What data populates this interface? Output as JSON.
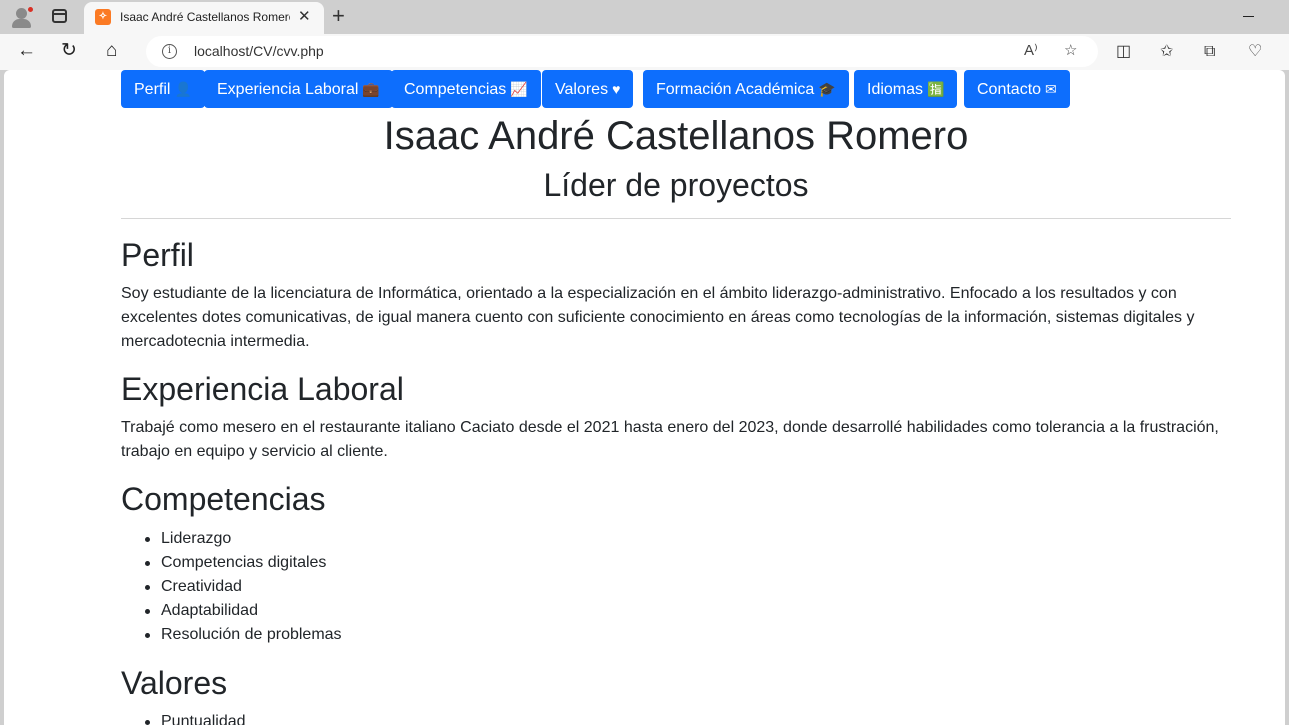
{
  "browser": {
    "tab_title": "Isaac André Castellanos Romero",
    "favicon_glyph": "✧",
    "url": "localhost/CV/cvv.php"
  },
  "nav": [
    {
      "label": "Perfil",
      "icon": "user-icon",
      "glyph": "👤"
    },
    {
      "label": "Experiencia Laboral",
      "icon": "briefcase-icon",
      "glyph": "💼"
    },
    {
      "label": "Competencias",
      "icon": "chart-line-icon",
      "glyph": "📈"
    },
    {
      "label": "Valores",
      "icon": "heart-icon",
      "glyph": "♥"
    },
    {
      "label": "Formación Académica",
      "icon": "graduation-cap-icon",
      "glyph": "🎓"
    },
    {
      "label": "Idiomas",
      "icon": "language-icon",
      "glyph": "🈯"
    },
    {
      "label": "Contacto",
      "icon": "envelope-icon",
      "glyph": "✉"
    }
  ],
  "header": {
    "name": "Isaac André Castellanos Romero",
    "role": "Líder de proyectos"
  },
  "sections": {
    "perfil": {
      "title": "Perfil",
      "text": "Soy estudiante de la licenciatura de Informática, orientado a la especialización en el ámbito liderazgo-administrativo. Enfocado a los resultados y con excelentes dotes comunicativas, de igual manera cuento con suficiente conocimiento en áreas como tecnologías de la información, sistemas digitales y mercadotecnia intermedia."
    },
    "experiencia": {
      "title": "Experiencia Laboral",
      "text": "Trabajé como mesero en el restaurante italiano Caciato desde el 2021 hasta enero del 2023, donde desarrollé habilidades como tolerancia a la frustración, trabajo en equipo y servicio al cliente."
    },
    "competencias": {
      "title": "Competencias",
      "items": [
        "Liderazgo",
        "Competencias digitales",
        "Creatividad",
        "Adaptabilidad",
        "Resolución de problemas"
      ]
    },
    "valores": {
      "title": "Valores",
      "items": [
        "Puntualidad"
      ]
    }
  },
  "colors": {
    "primary": "#0d6efd",
    "text": "#212529"
  }
}
